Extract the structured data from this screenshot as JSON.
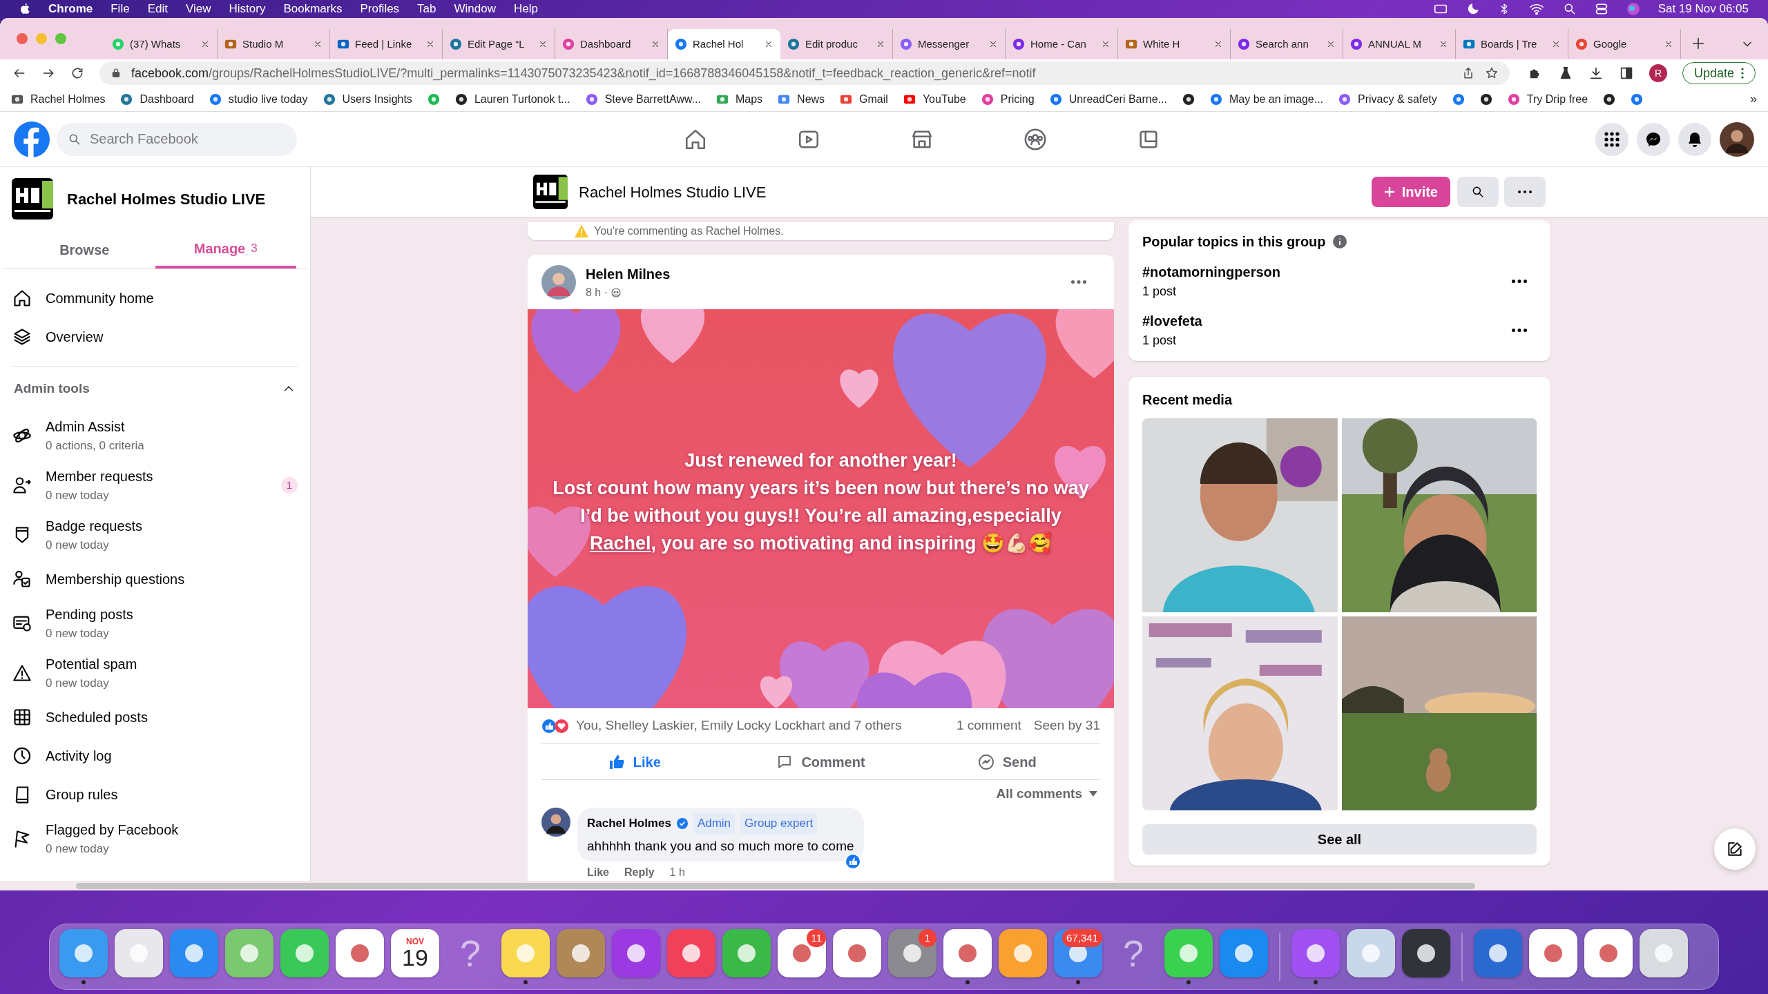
{
  "menu_bar": {
    "app": "Chrome",
    "menus": [
      "File",
      "Edit",
      "View",
      "History",
      "Bookmarks",
      "Profiles",
      "Tab",
      "Window",
      "Help"
    ],
    "clock": "Sat 19 Nov  06:05"
  },
  "tabs": [
    {
      "title": "(37) Whats",
      "kind": "whatsapp",
      "selected": false
    },
    {
      "title": "Studio M",
      "kind": "book",
      "selected": false
    },
    {
      "title": "Feed | Linke",
      "kind": "linkedin",
      "selected": false
    },
    {
      "title": "Edit Page “L",
      "kind": "wordpress",
      "selected": false
    },
    {
      "title": "Dashboard",
      "kind": "drip",
      "selected": false
    },
    {
      "title": "Rachel Hol",
      "kind": "facebook",
      "selected": true
    },
    {
      "title": "Edit produc",
      "kind": "wordpress",
      "selected": false
    },
    {
      "title": "Messenger",
      "kind": "messenger",
      "selected": false
    },
    {
      "title": "Home - Can",
      "kind": "canva",
      "selected": false
    },
    {
      "title": "White H",
      "kind": "book",
      "selected": false
    },
    {
      "title": "Search ann",
      "kind": "canva",
      "selected": false
    },
    {
      "title": "ANNUAL M",
      "kind": "canva",
      "selected": false
    },
    {
      "title": "Boards | Tre",
      "kind": "trello",
      "selected": false
    },
    {
      "title": "Google",
      "kind": "google",
      "selected": false
    }
  ],
  "address_bar": {
    "host": "facebook.com",
    "path": "/groups/RachelHolmesStudioLIVE/?multi_permalinks=1143075073235423&notif_id=1668788346045158&notif_t=feedback_reaction_generic&ref=notif"
  },
  "profile_initial": "R",
  "update_button": "Update",
  "bookmarks": [
    {
      "label": "Rachel Holmes",
      "kind": "box"
    },
    {
      "label": "Dashboard",
      "kind": "wordpress"
    },
    {
      "label": "studio live today",
      "kind": "facebook"
    },
    {
      "label": "Users Insights",
      "kind": "wordpress"
    },
    {
      "kind": "spotify"
    },
    {
      "label": "Lauren Turtonok t...",
      "kind": "globe"
    },
    {
      "label": "Steve BarrettAww...",
      "kind": "messenger"
    },
    {
      "label": "Maps",
      "kind": "maps"
    },
    {
      "label": "News",
      "kind": "news"
    },
    {
      "label": "Gmail",
      "kind": "gmail"
    },
    {
      "label": "YouTube",
      "kind": "youtube"
    },
    {
      "label": "Pricing",
      "kind": "drip"
    },
    {
      "label": "UnreadCeri Barne...",
      "kind": "facebook"
    },
    {
      "kind": "globe"
    },
    {
      "label": "May be an image...",
      "kind": "facebook"
    },
    {
      "label": "Privacy & safety",
      "kind": "messenger"
    },
    {
      "kind": "facebook"
    },
    {
      "kind": "globe"
    },
    {
      "label": "Try Drip free",
      "kind": "drip"
    },
    {
      "kind": "globe"
    },
    {
      "kind": "facebook"
    }
  ],
  "bookmarks_more": "»",
  "facebook_header": {
    "search_placeholder": "Search Facebook"
  },
  "group": {
    "name": "Rachel Holmes Studio LIVE",
    "invite": "Invite"
  },
  "sidebar": {
    "title": "Rachel Holmes Studio LIVE",
    "tabs": [
      {
        "label": "Browse",
        "selected": false
      },
      {
        "label": "Manage",
        "count": "3",
        "selected": true
      }
    ],
    "items": [
      {
        "label": "Community home",
        "kind": "home"
      },
      {
        "label": "Overview",
        "kind": "layers"
      }
    ],
    "section": {
      "title": "Admin tools",
      "expanded": true
    },
    "admin_items": [
      {
        "label": "Admin Assist",
        "sub": "0 actions, 0 criteria",
        "kind": "assist"
      },
      {
        "label": "Member requests",
        "sub": "0 new today",
        "kind": "person",
        "badge": "1"
      },
      {
        "label": "Badge requests",
        "sub": "0 new today",
        "kind": "badge"
      },
      {
        "label": "Membership questions",
        "kind": "question"
      },
      {
        "label": "Pending posts",
        "sub": "0 new today",
        "kind": "pending"
      },
      {
        "label": "Potential spam",
        "sub": "0 new today",
        "kind": "warning"
      },
      {
        "label": "Scheduled posts",
        "kind": "calendar"
      },
      {
        "label": "Activity log",
        "kind": "clock"
      },
      {
        "label": "Group rules",
        "kind": "book"
      },
      {
        "label": "Flagged by Facebook",
        "sub": "0 new today",
        "kind": "flag"
      }
    ]
  },
  "comment_notice": "You're commenting as Rachel Holmes.",
  "post": {
    "author": "Helen Milnes",
    "time": "8 h ·",
    "image_text": {
      "heading": "Just renewed for another year!",
      "before": "Lost count how many years it’s been now but there’s no way I’d be without you guys!! You’re all amazing,especially ",
      "mention": "Rachel",
      "after": ", you are so motivating and inspiring 🤩💪🏻🥰"
    },
    "reactions": "You, Shelley Laskier, Emily Locky Lockhart and 7 others",
    "comments_count": "1 comment",
    "seen": "Seen by 31",
    "actions": [
      {
        "label": "Like",
        "kind": "like",
        "selected": true
      },
      {
        "label": "Comment",
        "kind": "comment",
        "selected": false
      },
      {
        "label": "Send",
        "kind": "send",
        "selected": false
      }
    ],
    "sort": "All comments",
    "comment": {
      "author": "Rachel Holmes",
      "tags": [
        "Admin",
        "Group expert"
      ],
      "text": "ahhhhh thank you and so much more to come",
      "links": [
        "Like",
        "Reply"
      ],
      "time": "1 h"
    }
  },
  "popular_topics": {
    "title": "Popular topics in this group",
    "topics": [
      {
        "tag": "#notamorningperson",
        "count": "1 post"
      },
      {
        "tag": "#lovefeta",
        "count": "1 post"
      }
    ]
  },
  "recent_media": {
    "title": "Recent media",
    "see_all": "See all"
  },
  "dock": [
    {
      "kind": "finder",
      "running": true
    },
    {
      "kind": "launchpad",
      "running": false
    },
    {
      "kind": "safari",
      "running": false
    },
    {
      "kind": "maps",
      "running": false
    },
    {
      "kind": "facetime",
      "running": false
    },
    {
      "kind": "photos",
      "running": false
    },
    {
      "kind": "calendar",
      "month": "NOV",
      "day": "19",
      "running": false
    },
    {
      "kind": "unknown",
      "glyph": "?",
      "running": false
    },
    {
      "kind": "notes",
      "running": true
    },
    {
      "kind": "contacts",
      "running": false
    },
    {
      "kind": "podcasts",
      "running": false
    },
    {
      "kind": "music",
      "running": false
    },
    {
      "kind": "numbers",
      "running": false
    },
    {
      "kind": "reminders",
      "badge": "11",
      "running": false
    },
    {
      "kind": "news",
      "running": false
    },
    {
      "kind": "settings",
      "badge": "1",
      "running": false
    },
    {
      "kind": "chrome",
      "running": true
    },
    {
      "kind": "pages",
      "running": false
    },
    {
      "kind": "mail",
      "badge": "67,341",
      "running": true
    },
    {
      "kind": "unknown",
      "glyph": "?",
      "running": false
    },
    {
      "kind": "messages",
      "running": true
    },
    {
      "kind": "appstore",
      "running": false
    },
    {
      "kind": "messenger",
      "running": true
    },
    {
      "kind": "preview",
      "running": false
    },
    {
      "kind": "quicktime",
      "running": false
    },
    {
      "kind": "globe",
      "running": false
    },
    {
      "kind": "window",
      "running": false
    },
    {
      "kind": "window",
      "running": false
    },
    {
      "kind": "trash",
      "running": false
    }
  ]
}
